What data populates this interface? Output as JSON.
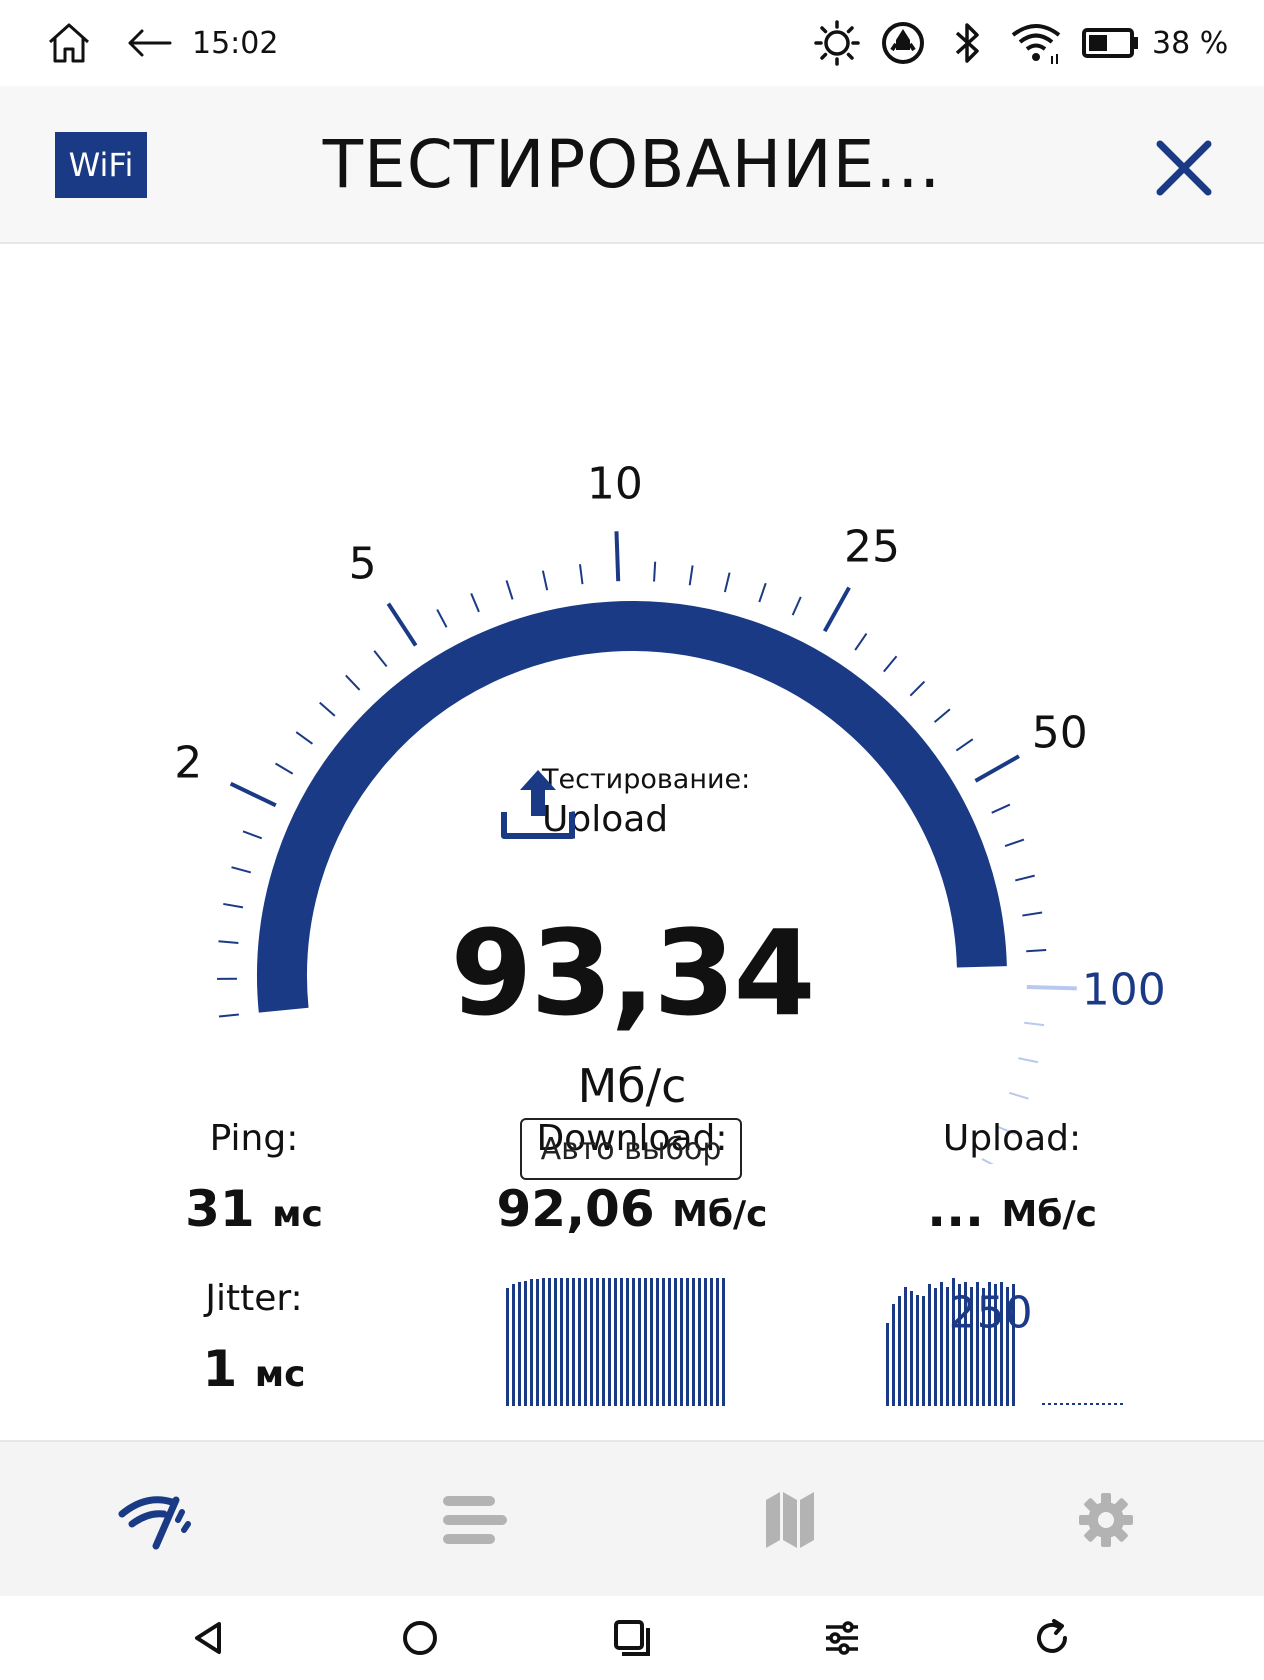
{
  "status_bar": {
    "time": "15:02",
    "battery": "38 %",
    "icons": [
      "home-icon",
      "back-arrow-icon",
      "brightness-icon",
      "vpn-icon",
      "bluetooth-icon",
      "wifi-icon",
      "battery-icon"
    ]
  },
  "header": {
    "badge": "WiFi",
    "title": "ТЕСТИРОВАНИЕ...",
    "close_icon": "close-icon"
  },
  "gauge": {
    "scale_labels": [
      "2",
      "5",
      "10",
      "25",
      "50",
      "100",
      "250"
    ],
    "accent_color": "#1b3a86",
    "inactive_color": "#b9c8ef",
    "current_value_mbps": 93.34
  },
  "phase": {
    "label": "Тестирование:",
    "value": "Upload",
    "icon": "upload-icon"
  },
  "speed": {
    "value": "93,34",
    "unit": "Мб/с"
  },
  "auto_select": {
    "label": "Авто выбор"
  },
  "stats": {
    "ping": {
      "label": "Ping:",
      "value": "31",
      "unit": "мс"
    },
    "jitter": {
      "label": "Jitter:",
      "value": "1",
      "unit": "мс"
    },
    "download": {
      "label": "Download:",
      "value": "92,06",
      "unit": "Мб/с"
    },
    "upload": {
      "label": "Upload:",
      "value": "...",
      "unit": "Мб/с"
    }
  },
  "history": {
    "download": [
      0.92,
      0.95,
      0.97,
      0.98,
      0.99,
      0.99,
      1,
      1,
      1,
      1,
      1,
      1,
      1,
      1,
      1,
      1,
      1,
      1,
      1,
      1,
      1,
      1,
      1,
      1,
      1,
      1,
      1,
      1,
      1,
      1,
      1,
      1,
      1,
      1,
      1,
      1,
      1
    ],
    "upload": [
      0.65,
      0.8,
      0.86,
      0.93,
      0.9,
      0.87,
      0.86,
      0.95,
      0.92,
      0.97,
      0.93,
      1,
      0.95,
      0.97,
      0.93,
      0.97,
      0.92,
      0.97,
      0.95,
      0.97,
      0.93,
      0.95
    ]
  },
  "bottom_nav": {
    "items": [
      "speedtest-icon",
      "results-list-icon",
      "map-icon",
      "settings-gear-icon"
    ]
  },
  "system_nav": {
    "items": [
      "system-back-icon",
      "system-home-icon",
      "system-recents-icon",
      "system-equalizer-icon",
      "system-refresh-icon"
    ]
  }
}
